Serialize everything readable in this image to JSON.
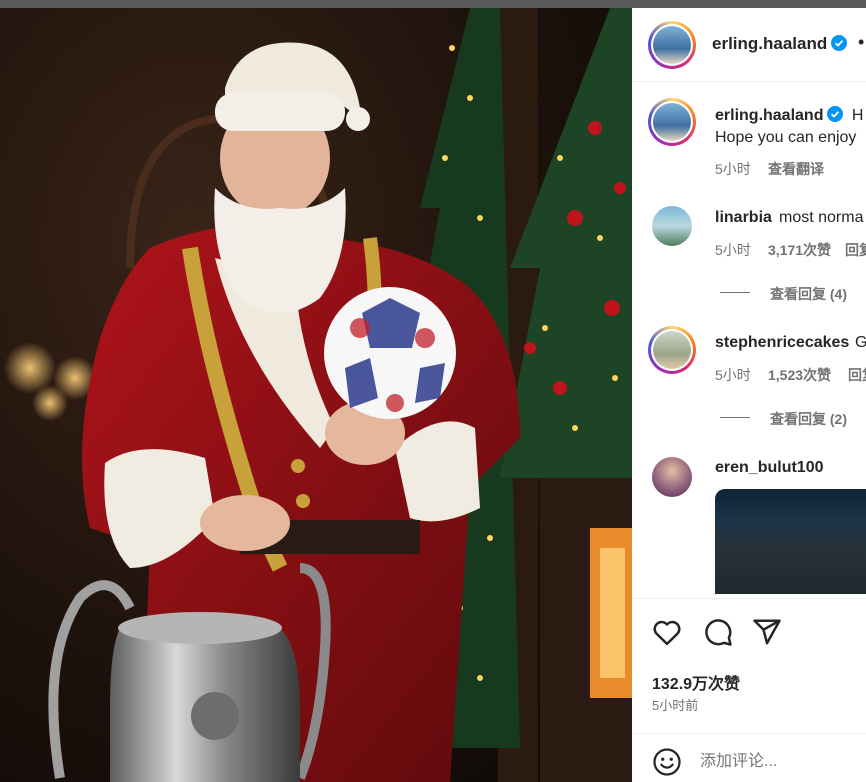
{
  "post": {
    "author": "erling.haaland",
    "more": "•",
    "caption_start": "H",
    "caption_line2": "Hope you can enjoy",
    "caption_time": "5小时",
    "translate": "查看翻译"
  },
  "comments": [
    {
      "user": "linarbia",
      "text": "most norma",
      "time": "5小时",
      "likes": "3,171次赞",
      "reply": "回复",
      "view_replies": "查看回复 (4)"
    },
    {
      "user": "stephenricecakes",
      "text": "G",
      "time": "5小时",
      "likes": "1,523次赞",
      "reply": "回复",
      "view_replies": "查看回复 (2)"
    },
    {
      "user": "eren_bulut100"
    }
  ],
  "actions": {
    "like_count": "132.9万次赞",
    "posted": "5小时前",
    "comment_placeholder": "添加评论..."
  },
  "colors": {
    "verified": "#0095f6",
    "muted": "#737373",
    "text": "#262626"
  }
}
